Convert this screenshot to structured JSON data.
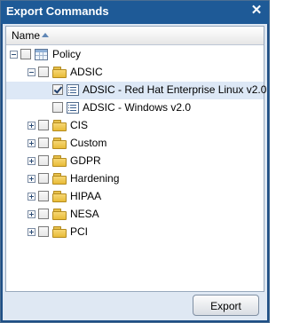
{
  "dialog": {
    "title": "Export Commands",
    "close_symbol": "✕"
  },
  "column_header": {
    "name": "Name",
    "sort": "ascending"
  },
  "tree": {
    "policy": {
      "label": "Policy",
      "expanded": true,
      "checked": false
    },
    "adsic": {
      "label": "ADSIC",
      "expanded": true,
      "checked": false
    },
    "adsic_children": [
      {
        "label": "ADSIC - Red Hat Enterprise Linux v2.0",
        "checked": true,
        "selected": true
      },
      {
        "label": "ADSIC - Windows v2.0",
        "checked": false,
        "selected": false
      }
    ],
    "folders": [
      {
        "label": "CIS",
        "expanded": false,
        "checked": false
      },
      {
        "label": "Custom",
        "expanded": false,
        "checked": false
      },
      {
        "label": "GDPR",
        "expanded": false,
        "checked": false
      },
      {
        "label": "Hardening",
        "expanded": false,
        "checked": false
      },
      {
        "label": "HIPAA",
        "expanded": false,
        "checked": false
      },
      {
        "label": "NESA",
        "expanded": false,
        "checked": false
      },
      {
        "label": "PCI",
        "expanded": false,
        "checked": false
      }
    ]
  },
  "footer": {
    "export_label": "Export"
  },
  "colors": {
    "titlebar": "#1e5a97",
    "body": "#dfe8f3",
    "selection": "#dde8f6",
    "folder": "#e8bb37"
  }
}
